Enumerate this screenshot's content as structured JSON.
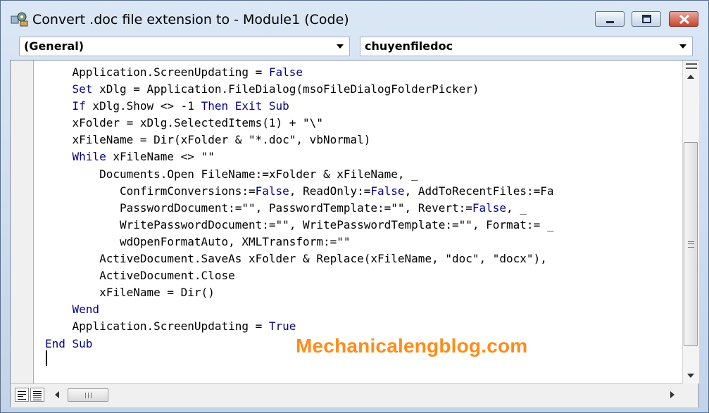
{
  "window": {
    "title": "Convert .doc file extension to  - Module1 (Code)",
    "icon": "vba-project-icon",
    "controls": [
      "minimize-icon",
      "maximize-icon",
      "close-icon"
    ]
  },
  "object_dropdown": {
    "selected": "(General)"
  },
  "procedure_dropdown": {
    "selected": "chuyenfiledoc"
  },
  "code": {
    "keyword_color": "#00008b",
    "lines": [
      "    Application.ScreenUpdating = False",
      "    Set xDlg = Application.FileDialog(msoFileDialogFolderPicker)",
      "    If xDlg.Show <> -1 Then Exit Sub",
      "    xFolder = xDlg.SelectedItems(1) + \"\\\"",
      "    xFileName = Dir(xFolder & \"*.doc\", vbNormal)",
      "    While xFileName <> \"\"",
      "        Documents.Open FileName:=xFolder & xFileName, _",
      "           ConfirmConversions:=False, ReadOnly:=False, AddToRecentFiles:=Fa",
      "           PasswordDocument:=\"\", PasswordTemplate:=\"\", Revert:=False, _",
      "           WritePasswordDocument:=\"\", WritePasswordTemplate:=\"\", Format:= _",
      "           wdOpenFormatAuto, XMLTransform:=\"\"",
      "        ActiveDocument.SaveAs xFolder & Replace(xFileName, \"doc\", \"docx\"),",
      "        ActiveDocument.Close",
      "        xFileName = Dir()",
      "    Wend",
      "    Application.ScreenUpdating = True",
      "End Sub",
      ""
    ]
  },
  "watermark": {
    "text": "Mechanicalengblog.com",
    "color": "#ff8c1a"
  },
  "view_buttons": [
    "procedure-view-icon",
    "full-module-view-icon"
  ]
}
